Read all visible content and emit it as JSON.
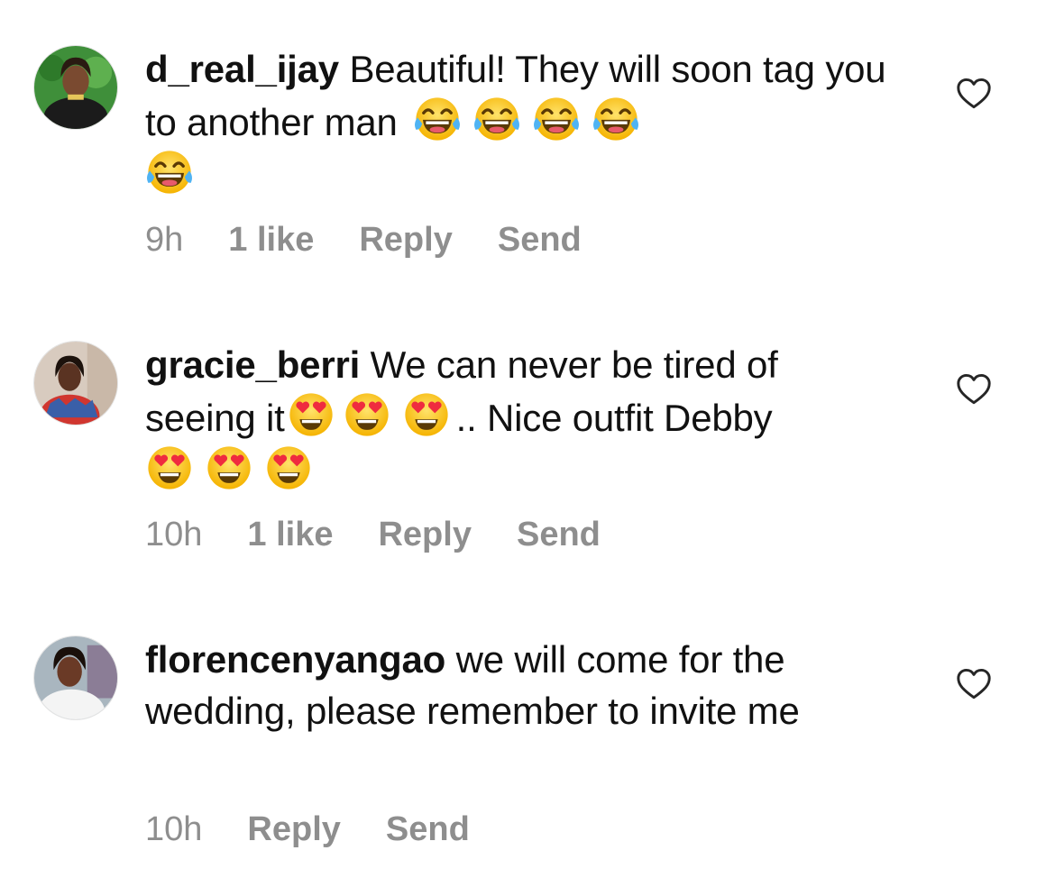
{
  "comments": [
    {
      "username": "d_real_ijay",
      "text_before": "Beautiful! They will soon tag you to another man",
      "emoji": "laughing-crying",
      "emoji_count_line1": 4,
      "emoji_count_line2": 1,
      "time": "9h",
      "likes": "1 like",
      "reply": "Reply",
      "send": "Send"
    },
    {
      "username": "gracie_berri",
      "text_before": "We can never be tired of seeing it",
      "text_after": ".. Nice outfit Debby",
      "emoji": "heart-eyes",
      "time": "10h",
      "likes": "1 like",
      "reply": "Reply",
      "send": "Send"
    },
    {
      "username": "florencenyangao",
      "text_before": "we will come for the wedding, please remember to invite me",
      "time": "10h",
      "reply": "Reply",
      "send": "Send"
    }
  ],
  "icons": {
    "like": "heart-outline-icon",
    "laughing": "face-with-tears-of-joy-emoji",
    "heart_eyes": "smiling-face-with-heart-eyes-emoji"
  },
  "colors": {
    "text": "#111111",
    "meta": "#8e8e8e",
    "background": "#ffffff"
  }
}
